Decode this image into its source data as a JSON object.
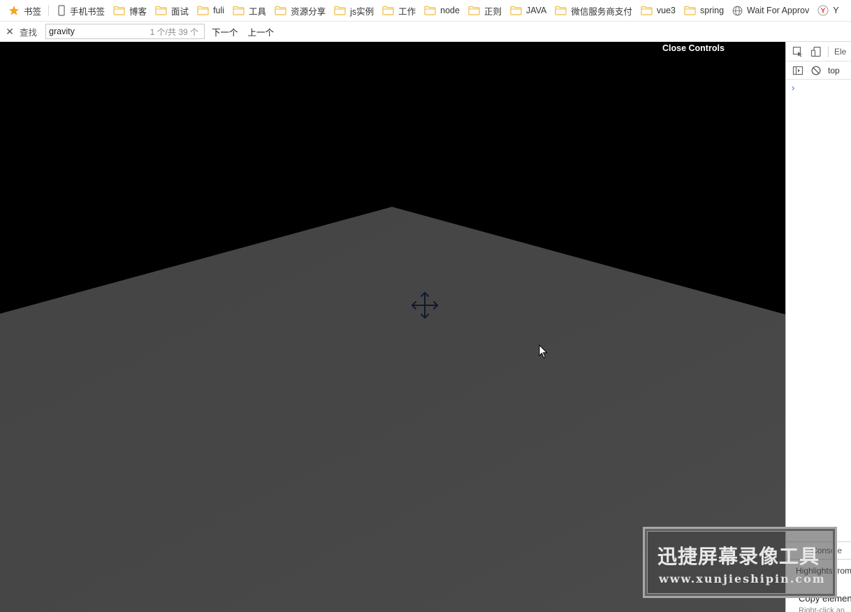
{
  "bookmarks_bar": {
    "items": [
      {
        "label": "书签",
        "icon": "star-icon"
      },
      {
        "label": "手机书签",
        "icon": "phone-icon"
      },
      {
        "label": "博客",
        "icon": "folder-icon"
      },
      {
        "label": "面试",
        "icon": "folder-icon"
      },
      {
        "label": "fuli",
        "icon": "folder-icon"
      },
      {
        "label": "工具",
        "icon": "folder-icon"
      },
      {
        "label": "资源分享",
        "icon": "folder-icon"
      },
      {
        "label": "js实例",
        "icon": "folder-icon"
      },
      {
        "label": "工作",
        "icon": "folder-icon"
      },
      {
        "label": "node",
        "icon": "folder-icon"
      },
      {
        "label": "正则",
        "icon": "folder-icon"
      },
      {
        "label": "JAVA",
        "icon": "folder-icon"
      },
      {
        "label": "微信服务商支付",
        "icon": "folder-icon"
      },
      {
        "label": "vue3",
        "icon": "folder-icon"
      },
      {
        "label": "spring",
        "icon": "folder-icon"
      },
      {
        "label": "Wait For Approv",
        "icon": "globe-icon"
      },
      {
        "label": "Y",
        "icon": "yandex-icon"
      }
    ]
  },
  "find_bar": {
    "label": "查找",
    "query": "gravity",
    "match_count": "1 个/共 39 个",
    "next_label": "下一个",
    "prev_label": "上一个"
  },
  "viewport": {
    "close_controls_label": "Close Controls"
  },
  "devtools": {
    "elements_tab": "Ele",
    "context": "top",
    "console_tab": "Console",
    "highlights_text": "Highlights from",
    "copy_text": "Copy elemen",
    "right_click_text": "Right-click an"
  },
  "watermark": {
    "title": "迅捷屏幕录像工具",
    "url": "www.xunjieshipin.com"
  },
  "colors": {
    "sky": "#000000",
    "ground": "#454545",
    "folder": "#f2c55c",
    "star": "#f5a623",
    "devtools_prompt": "#1a73e8"
  }
}
